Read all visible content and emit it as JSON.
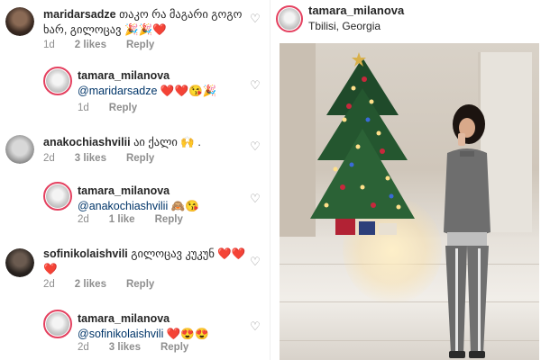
{
  "comments": [
    {
      "user": "maridarsadze",
      "text": "თაკო რა მაგარი გოგო ხარ, გილოცავ 🎉🎉❤️",
      "time": "1d",
      "likes": "2 likes",
      "reply": "Reply"
    },
    {
      "user": "tamara_milanova",
      "mention": "@maridarsadze",
      "text": "❤️❤️😘🎉",
      "time": "1d",
      "reply": "Reply"
    },
    {
      "user": "anakochiashvilii",
      "text": "აი ქალი 🙌 .",
      "time": "2d",
      "likes": "3 likes",
      "reply": "Reply"
    },
    {
      "user": "tamara_milanova",
      "mention": "@anakochiashvilii",
      "text": "🙈😘",
      "time": "2d",
      "likes": "1 like",
      "reply": "Reply"
    },
    {
      "user": "sofinikolaishvili",
      "text": "გილოცავ კუკუნ ❤️❤️❤️",
      "time": "2d",
      "likes": "2 likes",
      "reply": "Reply"
    },
    {
      "user": "tamara_milanova",
      "mention": "@sofinikolaishvili",
      "text": "❤️😍😍",
      "time": "2d",
      "likes": "3 likes",
      "reply": "Reply"
    }
  ],
  "post": {
    "user": "tamara_milanova",
    "location": "Tbilisi, Georgia"
  },
  "icons": {
    "like": "heart-outline-icon"
  },
  "colors": {
    "mention": "#003569",
    "meta": "#8e8e8e",
    "text": "#262626",
    "story_ring": "#e4405f"
  }
}
